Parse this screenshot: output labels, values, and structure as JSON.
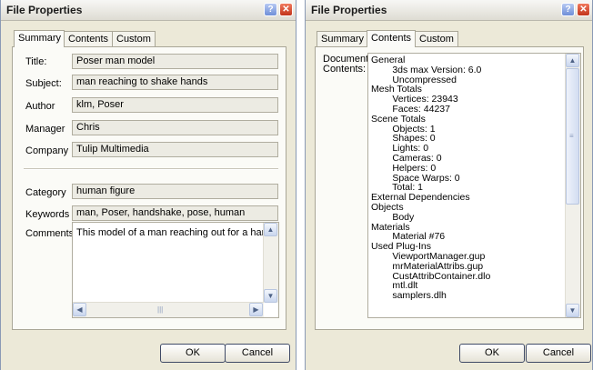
{
  "left": {
    "title": "File Properties",
    "help_label": "?",
    "close_label": "✕",
    "tabs": [
      "Summary",
      "Contents",
      "Custom"
    ],
    "fields": {
      "title_label": "Title:",
      "title_value": "Poser man model",
      "subject_label": "Subject:",
      "subject_value": "man reaching to shake hands",
      "author_label": "Author",
      "author_value": "klm, Poser",
      "manager_label": "Manager",
      "manager_value": "Chris",
      "company_label": "Company",
      "company_value": "Tulip Multimedia",
      "category_label": "Category",
      "category_value": "human figure",
      "keywords_label": "Keywords",
      "keywords_value": "man, Poser, handshake, pose, human",
      "comments_label": "Comments",
      "comments_value": "This model of a man reaching out for a handshake"
    },
    "ok_label": "OK",
    "cancel_label": "Cancel"
  },
  "right": {
    "title": "File Properties",
    "help_label": "?",
    "close_label": "✕",
    "tabs": [
      "Summary",
      "Contents",
      "Custom"
    ],
    "doc_label": "Document\nContents:",
    "contents": "General\n        3ds max Version: 6.0\n        Uncompressed\nMesh Totals\n        Vertices: 23943\n        Faces: 44237\nScene Totals\n        Objects: 1\n        Shapes: 0\n        Lights: 0\n        Cameras: 0\n        Helpers: 0\n        Space Warps: 0\n        Total: 1\nExternal Dependencies\nObjects\n        Body\nMaterials\n        Material #76\nUsed Plug-Ins\n        ViewportManager.gup\n        mrMaterialAttribs.gup\n        CustAttribContainer.dlo\n        mtl.dlt\n        samplers.dlh",
    "ok_label": "OK",
    "cancel_label": "Cancel"
  }
}
